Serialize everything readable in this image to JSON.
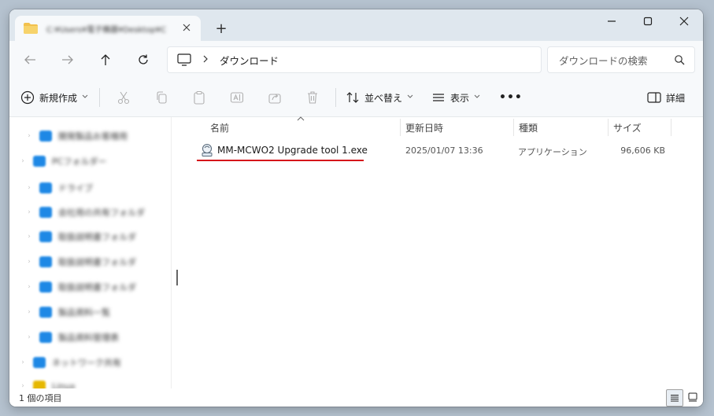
{
  "window": {
    "tab_title": "C:¥Users¥電子機器¥Desktop¥C",
    "new_tab": "+"
  },
  "address": {
    "location": "ダウンロード",
    "search_placeholder": "ダウンロードの検索"
  },
  "commands": {
    "new": "新規作成",
    "sort": "並べ替え",
    "view": "表示",
    "more": "•••",
    "details": "詳細"
  },
  "nav_pane": {
    "items": [
      {
        "label": "開発製品お客様用",
        "icon_color": "#1e88e5"
      },
      {
        "label": "PCフォルダー",
        "icon_color": "#1e88e5"
      },
      {
        "label": "ドライブ",
        "icon_color": "#1e88e5"
      },
      {
        "label": "会社用の共有フォルダ",
        "icon_color": "#1e88e5"
      },
      {
        "label": "取扱説明書フォルダ",
        "icon_color": "#1e88e5"
      },
      {
        "label": "取扱説明書フォルダ",
        "icon_color": "#1e88e5"
      },
      {
        "label": "取扱説明書フォルダ",
        "icon_color": "#1e88e5"
      },
      {
        "label": "製品資料一覧",
        "icon_color": "#1e88e5"
      },
      {
        "label": "製品資料管理表",
        "icon_color": "#1e88e5"
      },
      {
        "label": "ネットワーク共有",
        "icon_color": "#1e88e5"
      },
      {
        "label": "Linux",
        "icon_color": "#e6b800"
      }
    ]
  },
  "columns": {
    "name": "名前",
    "date": "更新日時",
    "type": "種類",
    "size": "サイズ"
  },
  "files": [
    {
      "name": "MM-MCWO2 Upgrade tool 1.exe",
      "date": "2025/01/07 13:36",
      "type": "アプリケーション",
      "size": "96,606 KB"
    }
  ],
  "status": {
    "item_count": "1 個の項目"
  },
  "colors": {
    "highlight_underline": "#d6151b",
    "accent": "#1e88e5"
  }
}
